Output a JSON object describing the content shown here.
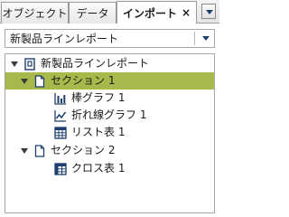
{
  "tabs": [
    {
      "label": "オブジェクト"
    },
    {
      "label": "データ"
    },
    {
      "label": "インポート"
    }
  ],
  "tab_close_icon": "close-icon",
  "tab_menu_icon": "chevron-down-icon",
  "report_selector": {
    "value": "新製品ラインレポート"
  },
  "tree": {
    "report": {
      "label": "新製品ラインレポート",
      "icon": "report-icon"
    },
    "sections": [
      {
        "label": "セクション 1",
        "icon": "page-icon",
        "selected": true,
        "items": [
          {
            "label": "棒グラフ 1",
            "icon": "bar-chart-icon"
          },
          {
            "label": "折れ線グラフ 1",
            "icon": "line-chart-icon"
          },
          {
            "label": "リスト表 1",
            "icon": "table-icon"
          }
        ]
      },
      {
        "label": "セクション 2",
        "icon": "page-icon",
        "selected": false,
        "items": [
          {
            "label": "クロス表 1",
            "icon": "crosstab-icon"
          }
        ]
      }
    ]
  },
  "colors": {
    "selection_bg": "#a8b84a",
    "icon_blue": "#1e3f6e"
  }
}
